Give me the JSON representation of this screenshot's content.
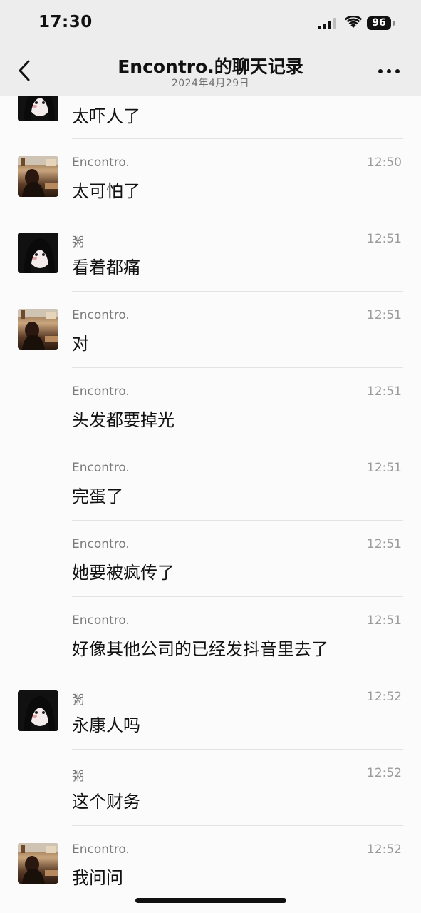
{
  "status_bar": {
    "time": "17:30",
    "battery": "96",
    "icons": [
      "cellular-signal-icon",
      "wifi-icon",
      "battery-icon"
    ]
  },
  "nav": {
    "title": "Encontro.的聊天记录",
    "subtitle": "2024年4月29日",
    "back_icon": "chevron-left-icon",
    "more_icon": "more-dots-icon"
  },
  "messages": [
    {
      "sender": "",
      "time": "",
      "text": "太吓人了",
      "avatar": "avatar-girl"
    },
    {
      "sender": "Encontro.",
      "time": "12:50",
      "text": "太可怕了",
      "avatar": "avatar-photo"
    },
    {
      "sender": "粥",
      "time": "12:51",
      "text": "看着都痛",
      "avatar": "avatar-girl"
    },
    {
      "sender": "Encontro.",
      "time": "12:51",
      "text": "对",
      "avatar": "avatar-photo"
    },
    {
      "sender": "Encontro.",
      "time": "12:51",
      "text": "头发都要掉光",
      "avatar": ""
    },
    {
      "sender": "Encontro.",
      "time": "12:51",
      "text": "完蛋了",
      "avatar": ""
    },
    {
      "sender": "Encontro.",
      "time": "12:51",
      "text": "她要被疯传了",
      "avatar": ""
    },
    {
      "sender": "Encontro.",
      "time": "12:51",
      "text": "好像其他公司的已经发抖音里去了",
      "avatar": ""
    },
    {
      "sender": "粥",
      "time": "12:52",
      "text": "永康人吗",
      "avatar": "avatar-girl"
    },
    {
      "sender": "粥",
      "time": "12:52",
      "text": "这个财务",
      "avatar": ""
    },
    {
      "sender": "Encontro.",
      "time": "12:52",
      "text": "我问问",
      "avatar": "avatar-photo"
    }
  ]
}
